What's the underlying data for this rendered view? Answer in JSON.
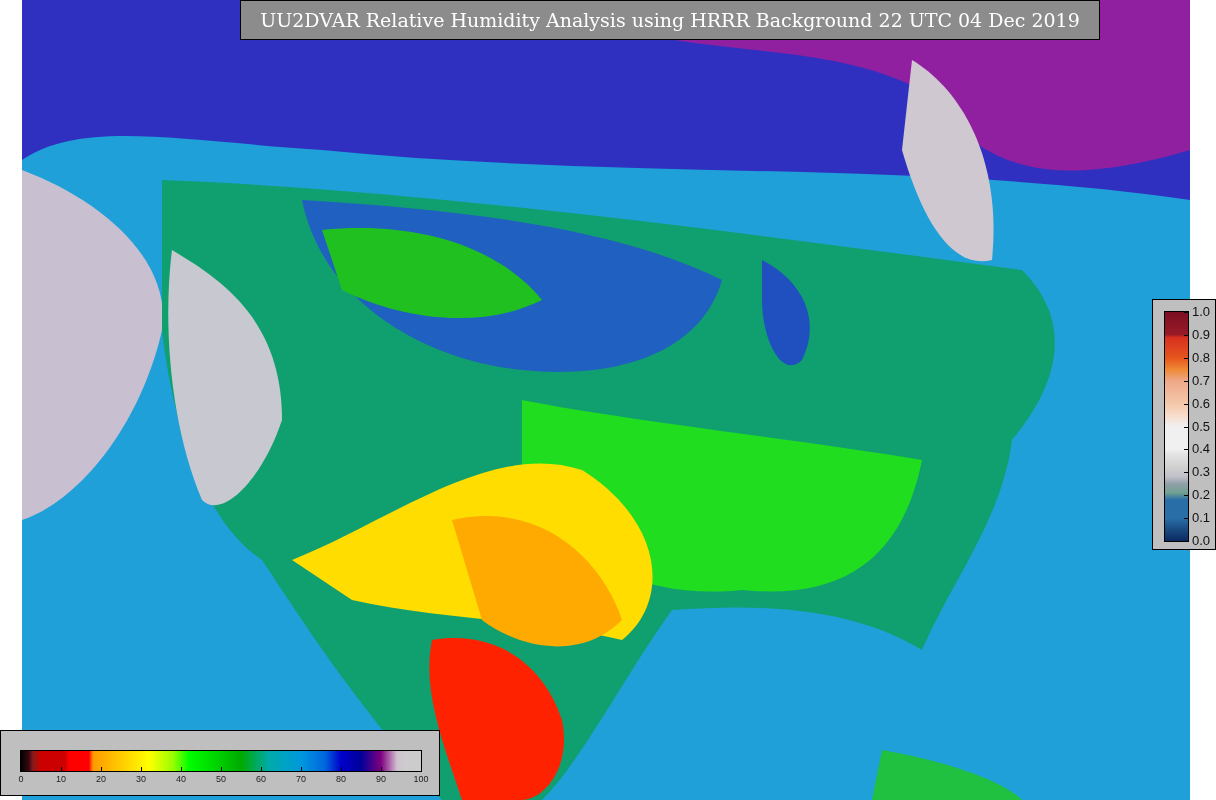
{
  "title": "UU2DVAR Relative Humidity Analysis using HRRR Background 22 UTC 04 Dec 2019",
  "humidity_legend": {
    "ticks": [
      "0",
      "10",
      "20",
      "30",
      "40",
      "50",
      "60",
      "70",
      "80",
      "90",
      "100"
    ]
  },
  "observation_legend": {
    "ticks": [
      "1.0",
      "0.9",
      "0.8",
      "0.7",
      "0.6",
      "0.5",
      "0.4",
      "0.3",
      "0.2",
      "0.1",
      "0.0"
    ]
  }
}
